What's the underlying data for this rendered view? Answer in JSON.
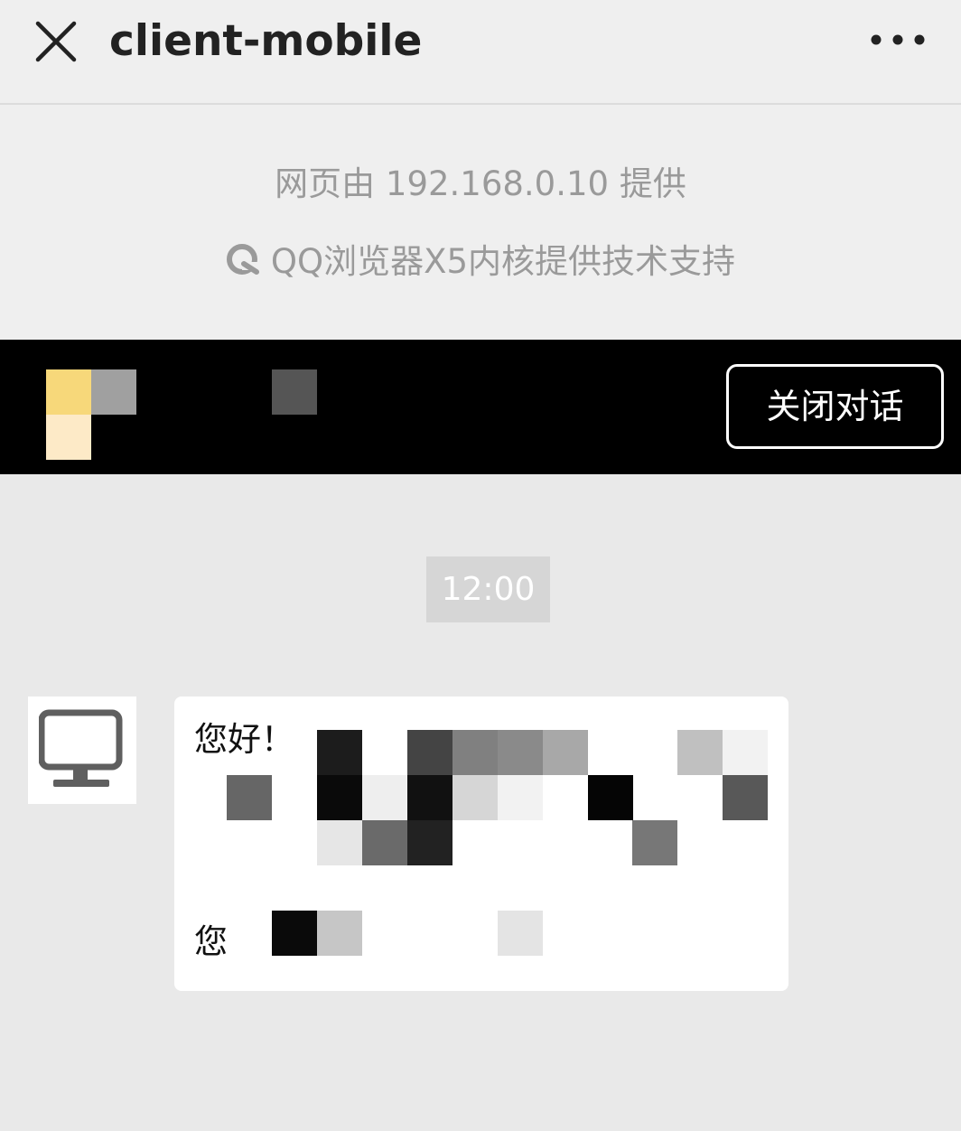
{
  "topbar": {
    "title": "client-mobile",
    "close_icon": "close-icon",
    "more_icon": "more-horizontal-icon"
  },
  "provider": {
    "source_text": "网页由 192.168.0.10 提供",
    "engine_text": "QQ浏览器X5内核提供技术支持",
    "engine_icon": "x5-browser-icon"
  },
  "chat_header": {
    "end_chat_label": "关闭对话"
  },
  "chat": {
    "timestamp": "12:00",
    "avatar_icon": "monitor-icon",
    "message": {
      "line1": "您好！",
      "line2": "您"
    }
  },
  "colors": {
    "header_bg": "#000000",
    "page_bg": "#e9e9e9",
    "topbar_bg": "#efefef",
    "muted_text": "#9a9a9a"
  }
}
